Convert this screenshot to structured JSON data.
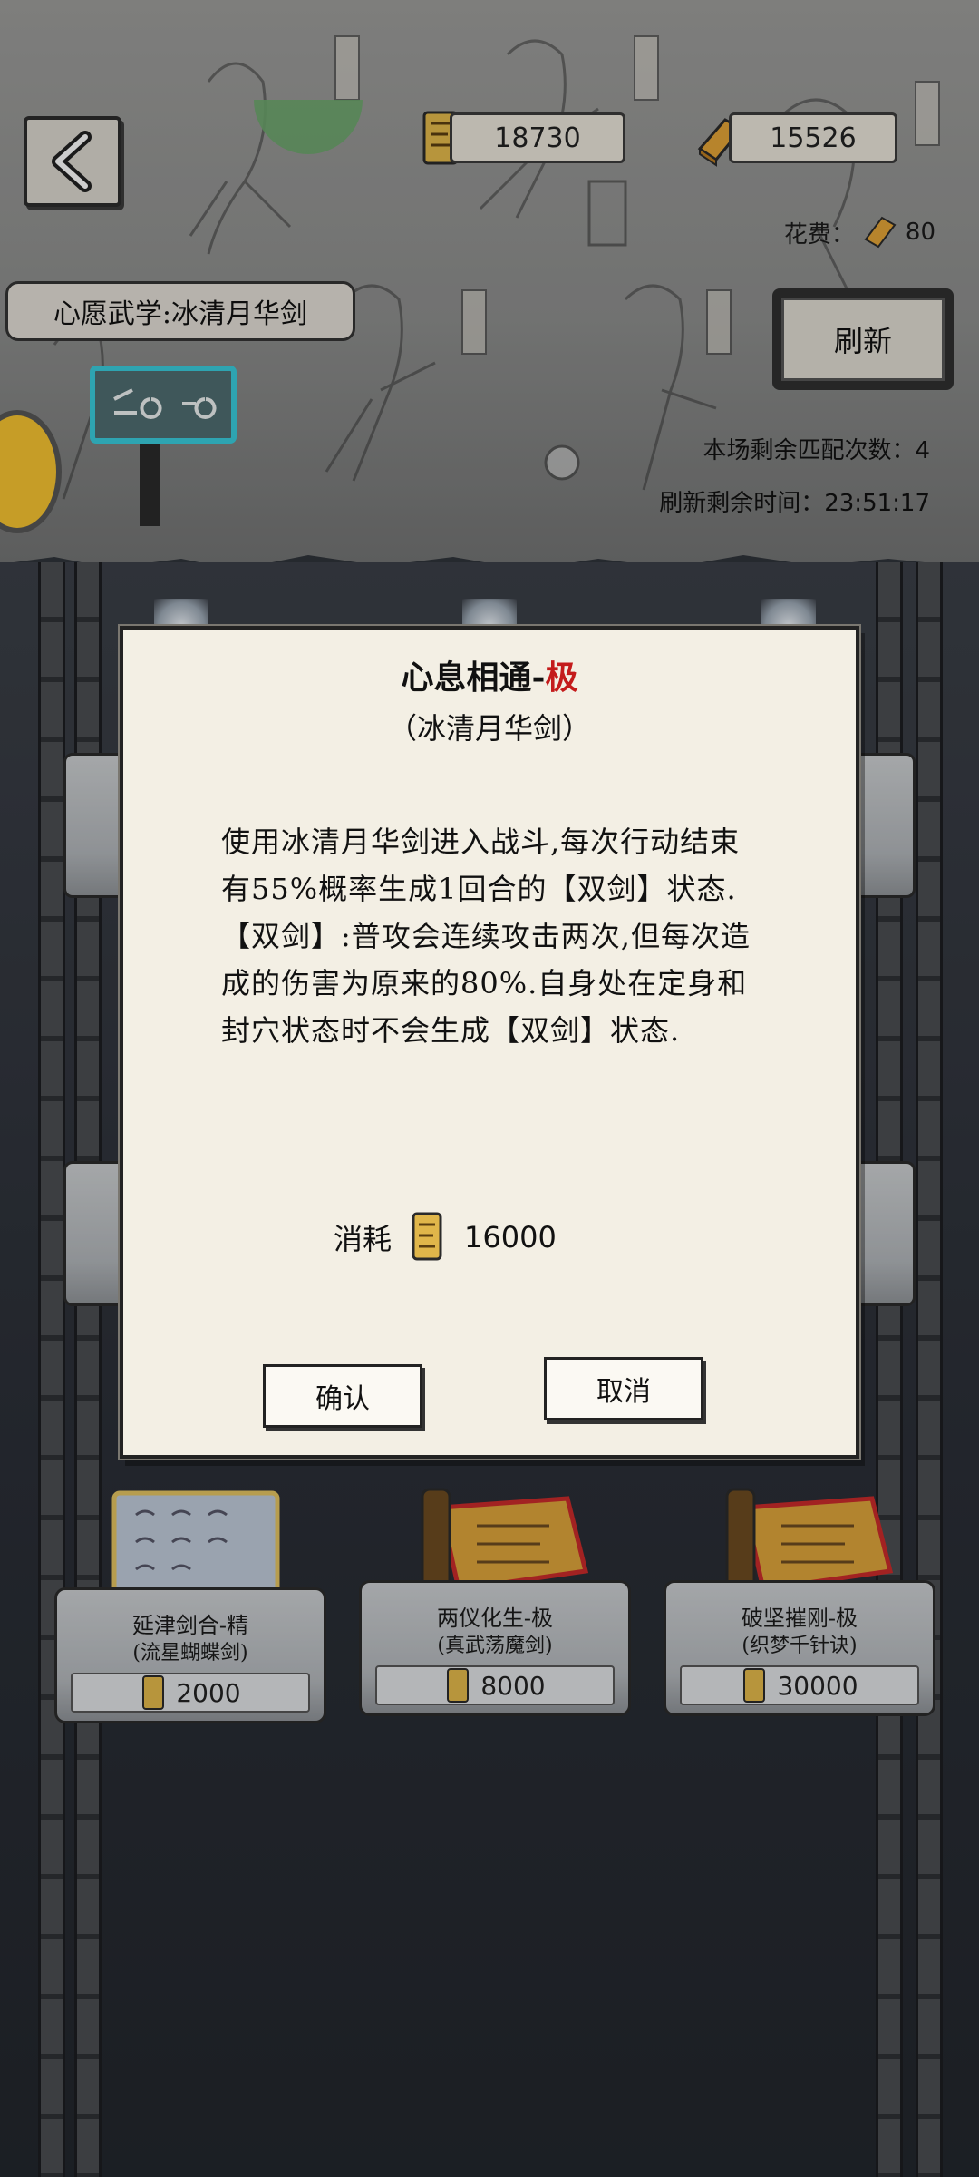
{
  "header": {
    "back_icon": "chevron-left-icon",
    "scroll_currency": "18730",
    "gold_currency": "15526",
    "cost_label": "花费：",
    "cost_value": "80",
    "wish_label": "心愿武学:冰清月华剑",
    "refresh_label": "刷新",
    "matches_remaining": "本场剩余匹配次数：4",
    "refresh_time": "刷新剩余时间：23:51:17"
  },
  "dialog": {
    "title_main": "心息相通-",
    "title_grade": "极",
    "subtitle": "（冰清月华剑）",
    "description": "使用冰清月华剑进入战斗,每次行动结束有55%概率生成1回合的【双剑】状态.【双剑】:普攻会连续攻击两次,但每次造成的伤害为原来的80%.自身处在定身和封穴状态时不会生成【双剑】状态.",
    "cost_label": "消耗",
    "cost_value": "16000",
    "confirm_label": "确认",
    "cancel_label": "取消"
  },
  "shop_items": [
    {
      "name": "延津剑合-精",
      "sub": "(流星蝴蝶剑)",
      "price": "2000"
    },
    {
      "name": "两仪化生-极",
      "sub": "(真武荡魔剑)",
      "price": "8000"
    },
    {
      "name": "破坚摧刚-极",
      "sub": "(织梦千针诀)",
      "price": "30000"
    }
  ],
  "colors": {
    "grade_red": "#c41b1b",
    "dialog_bg": "#f3efe4",
    "gold": "#d9a23a"
  }
}
